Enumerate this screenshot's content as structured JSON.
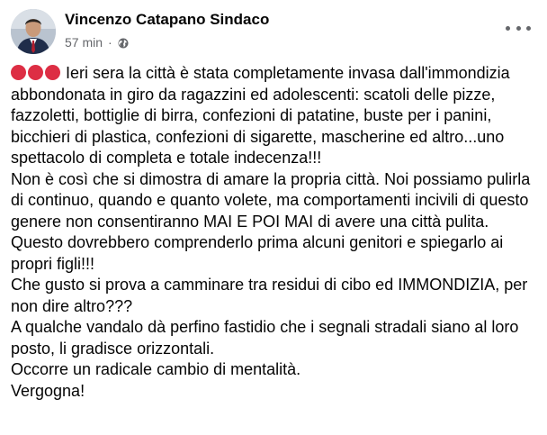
{
  "post": {
    "author": "Vincenzo Catapano Sindaco",
    "time": "57 min",
    "separator": "·",
    "privacy_icon": "globe-icon",
    "more_icon": "more-options-icon",
    "lead_emoji": "red-circle-icon",
    "paragraphs": [
      "Ieri sera la città è stata completamente invasa dall'immondizia abbondonata in giro da ragazzini ed adolescenti: scatoli delle pizze, fazzoletti, bottiglie di birra, confezioni di patatine, buste per i panini, bicchieri di plastica, confezioni di sigarette, mascherine ed altro...uno spettacolo di completa e totale indecenza!!!",
      "Non è così che si dimostra di amare la propria città. Noi possiamo pulirla di continuo, quando e quanto volete, ma comportamenti incivili di questo genere non consentiranno MAI E POI MAI di avere una città pulita.",
      "Questo dovrebbero comprenderlo prima alcuni genitori e spiegarlo ai propri figli!!!",
      "Che gusto si prova a camminare tra residui di cibo ed IMMONDIZIA, per non dire altro???",
      "A qualche vandalo dà perfino fastidio che i segnali stradali siano al loro posto, li gradisce orizzontali.",
      "Occorre un radicale cambio di mentalità.",
      "Vergogna!"
    ]
  },
  "colors": {
    "text": "#050505",
    "secondary_text": "#65676b",
    "alert_red": "#dd2e44"
  }
}
